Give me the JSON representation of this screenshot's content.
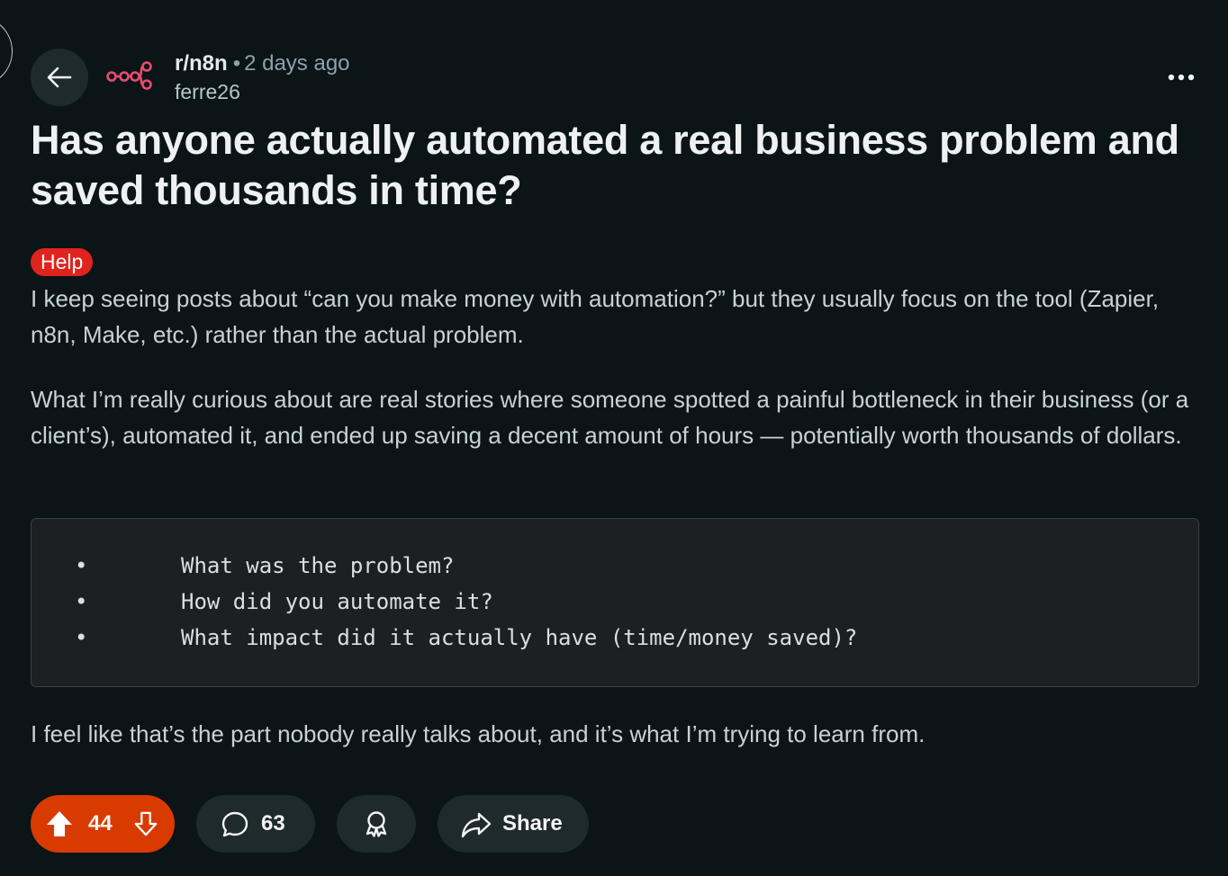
{
  "post": {
    "subreddit": "r/n8n",
    "separator": "•",
    "time_ago": "2 days ago",
    "author": "ferre26",
    "title": "Has anyone actually automated a real business problem and saved thousands in time?",
    "flair": "Help",
    "paragraphs": [
      "I keep seeing posts about “can you make money with automation?” but they usually focus on the tool (Zapier, n8n, Make, etc.) rather than the actual problem.",
      "What I’m really curious about are real stories where someone spotted a painful bottleneck in their business (or a client’s), automated it, and ended up saving a decent amount of hours — potentially worth thousands of dollars.",
      "I feel like that’s the part nobody really talks about, and it’s what I’m trying to learn from."
    ],
    "code_block": {
      "bullet": "•",
      "lines": [
        "What was the problem?",
        "How did you automate it?",
        "What impact did it actually have (time/money saved)?"
      ]
    }
  },
  "actions": {
    "vote_count": "44",
    "comment_count": "63",
    "share_label": "Share"
  },
  "colors": {
    "background": "#0b1416",
    "upvote_active": "#d93a00",
    "flair_help": "#e0231c",
    "n8n_brand": "#ea4b71",
    "pill": "#1f2a2d"
  },
  "icons": {
    "back": "arrow-left-icon",
    "subreddit": "n8n-logo-icon",
    "more": "more-horizontal-icon",
    "upvote": "upvote-arrow-icon",
    "downvote": "downvote-arrow-icon",
    "comment": "comment-bubble-icon",
    "award": "award-icon",
    "share": "share-arrow-icon"
  }
}
